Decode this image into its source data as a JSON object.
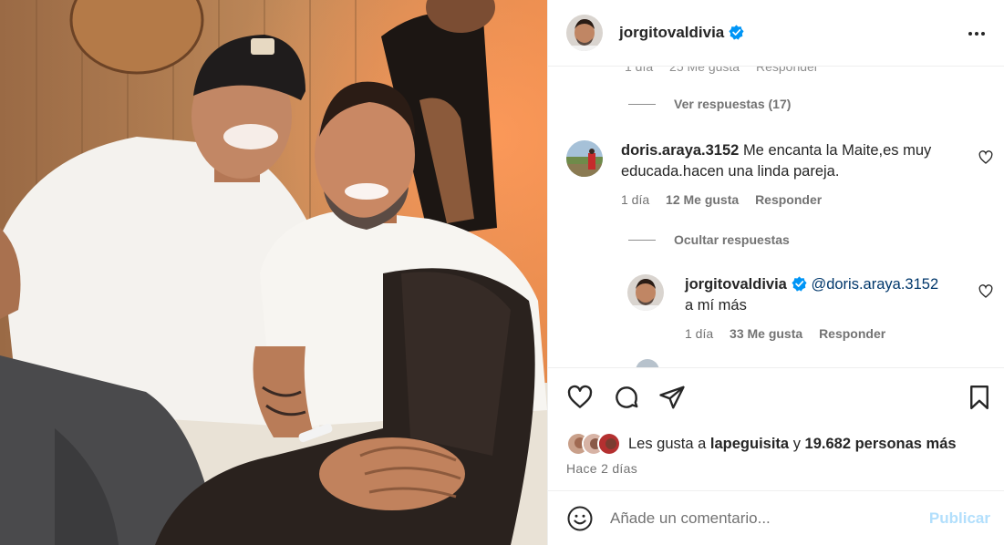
{
  "post": {
    "author": "jorgitovaldivia",
    "verified": true,
    "more_icon": "more-horizontal-icon",
    "photo_alt": "two-men-portrait"
  },
  "comments": {
    "cut_row": {
      "age": "1 día",
      "likes": "25 Me gusta",
      "reply": "Responder"
    },
    "view_replies": "Ver respuestas (17)",
    "hide_replies": "Ocultar respuestas",
    "items": [
      {
        "user": "doris.araya.3152",
        "text": "Me encanta la Maite,es muy educada.hacen una linda pareja.",
        "age": "1 día",
        "likes": "12 Me gusta",
        "reply": "Responder"
      }
    ],
    "reply": {
      "user": "jorgitovaldivia",
      "mention": "@doris.araya.3152",
      "text": "a mí más",
      "age": "1 día",
      "likes": "33 Me gusta",
      "reply": "Responder"
    }
  },
  "actions": {
    "like_icon": "heart-icon",
    "comment_icon": "comment-icon",
    "share_icon": "send-icon",
    "save_icon": "bookmark-icon"
  },
  "likes": {
    "prefix": "Les gusta a",
    "user": "lapeguisita",
    "joiner": "y",
    "others": "19.682 personas más"
  },
  "time_ago": "Hace 2 días",
  "add_comment": {
    "placeholder": "Añade un comentario...",
    "publish_label": "Publicar",
    "emoji_icon": "emoji-icon"
  },
  "colors": {
    "accent_blue": "#0095f6",
    "publish_disabled": "#b2dffc",
    "secondary_text": "#737373",
    "verified_blue": "#0095f6"
  }
}
